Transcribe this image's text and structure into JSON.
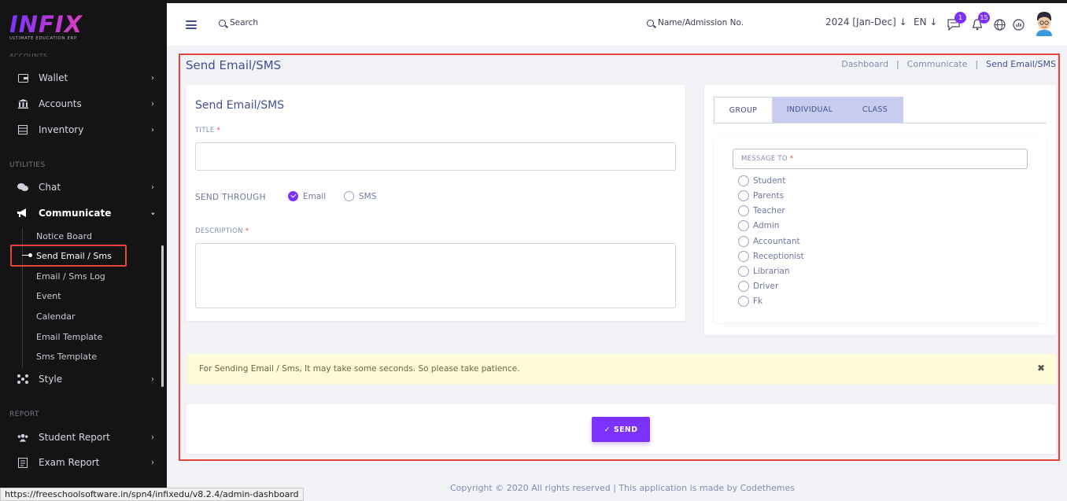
{
  "brand": {
    "logo_text": "INFIX",
    "logo_subtitle": "ULTIMATE EDUCATION ERP"
  },
  "sidebar": {
    "cut_section": "ACCOUNTS",
    "items_top": [
      {
        "label": "Wallet",
        "icon": "wallet-icon"
      },
      {
        "label": "Accounts",
        "icon": "bank-icon"
      },
      {
        "label": "Inventory",
        "icon": "inventory-icon"
      }
    ],
    "utilities_label": "UTILITIES",
    "chat_label": "Chat",
    "communicate_label": "Communicate",
    "sub_items": [
      "Notice Board",
      "Send Email / Sms",
      "Email / Sms Log",
      "Event",
      "Calendar",
      "Email Template",
      "Sms Template"
    ],
    "style_label": "Style",
    "report_label": "REPORT",
    "student_report_label": "Student Report",
    "exam_report_label": "Exam Report"
  },
  "header": {
    "search_label": "Search",
    "admission_search_label": "Name/Admission No.",
    "year_label": "2024 [Jan-Dec]",
    "lang_label": "EN",
    "messages_badge": "1",
    "notifications_badge": "15"
  },
  "page": {
    "title": "Send Email/SMS",
    "breadcrumb": [
      "Dashboard",
      "Communicate",
      "Send Email/SMS"
    ]
  },
  "form": {
    "card_title": "Send Email/SMS",
    "title_label": "TITLE",
    "required_mark": "*",
    "send_through_label": "SEND THROUGH",
    "option_email": "Email",
    "option_sms": "SMS",
    "description_label": "DESCRIPTION"
  },
  "recipients": {
    "tabs": [
      "GROUP",
      "INDIVIDUAL",
      "CLASS"
    ],
    "message_to_label": "MESSAGE TO",
    "options": [
      "Student",
      "Parents",
      "Teacher",
      "Admin",
      "Accountant",
      "Receptionist",
      "Librarian",
      "Driver",
      "Fk"
    ]
  },
  "alert": {
    "text": "For Sending Email / Sms, It may take some seconds. So please take patience.",
    "close": "✖"
  },
  "send_button": {
    "check": "✓",
    "label": "SEND"
  },
  "footer": {
    "text": "Copyright © 2020 All rights reserved | This application is made by Codethemes"
  },
  "statusbar": {
    "url": "https://freeschoolsoftware.in/spn4/infixedu/v8.2.4/admin-dashboard"
  },
  "colors": {
    "accent": "#7c32ff",
    "primary_text": "#415094",
    "highlight_border": "#e5453d",
    "alert_bg": "#fdfbd8"
  }
}
